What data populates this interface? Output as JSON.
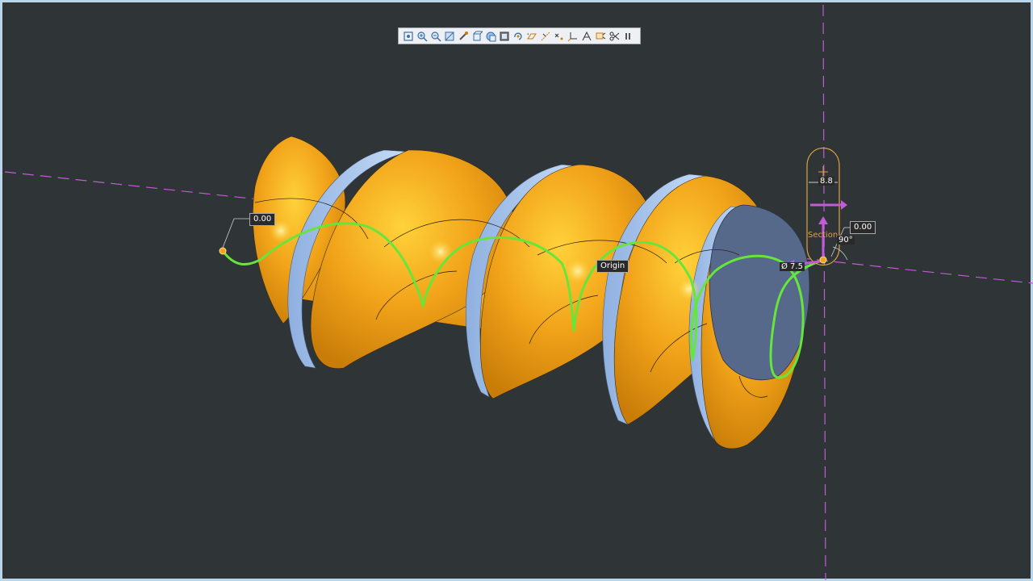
{
  "toolbar": {
    "icons": [
      "refit-icon",
      "zoom-in-icon",
      "zoom-out-icon",
      "repaint-icon",
      "pan-icon",
      "view-orientation-icon",
      "saved-views-icon",
      "display-style-icon",
      "spin-center-icon",
      "datum-display-icon",
      "axis-display-icon",
      "point-display-icon",
      "csys-display-icon",
      "annotation-display-icon",
      "tag-display-icon",
      "cut-icon",
      "pause-icon"
    ]
  },
  "viewport": {
    "origin_label": "Origin",
    "section_label": "Section",
    "dimensions": {
      "start_offset": "0.00",
      "end_offset": "0.00",
      "section_width": "8.8",
      "diameter": "Ø 7.5",
      "angle": "90°"
    }
  },
  "colors": {
    "background": "#2f3436",
    "screw_body": "#f2a41a",
    "screw_flank": "#a9c6f0",
    "sweep_trajectory": "#66e63a",
    "datum_axis": "#c25bd6",
    "end_face": "#56698a"
  }
}
